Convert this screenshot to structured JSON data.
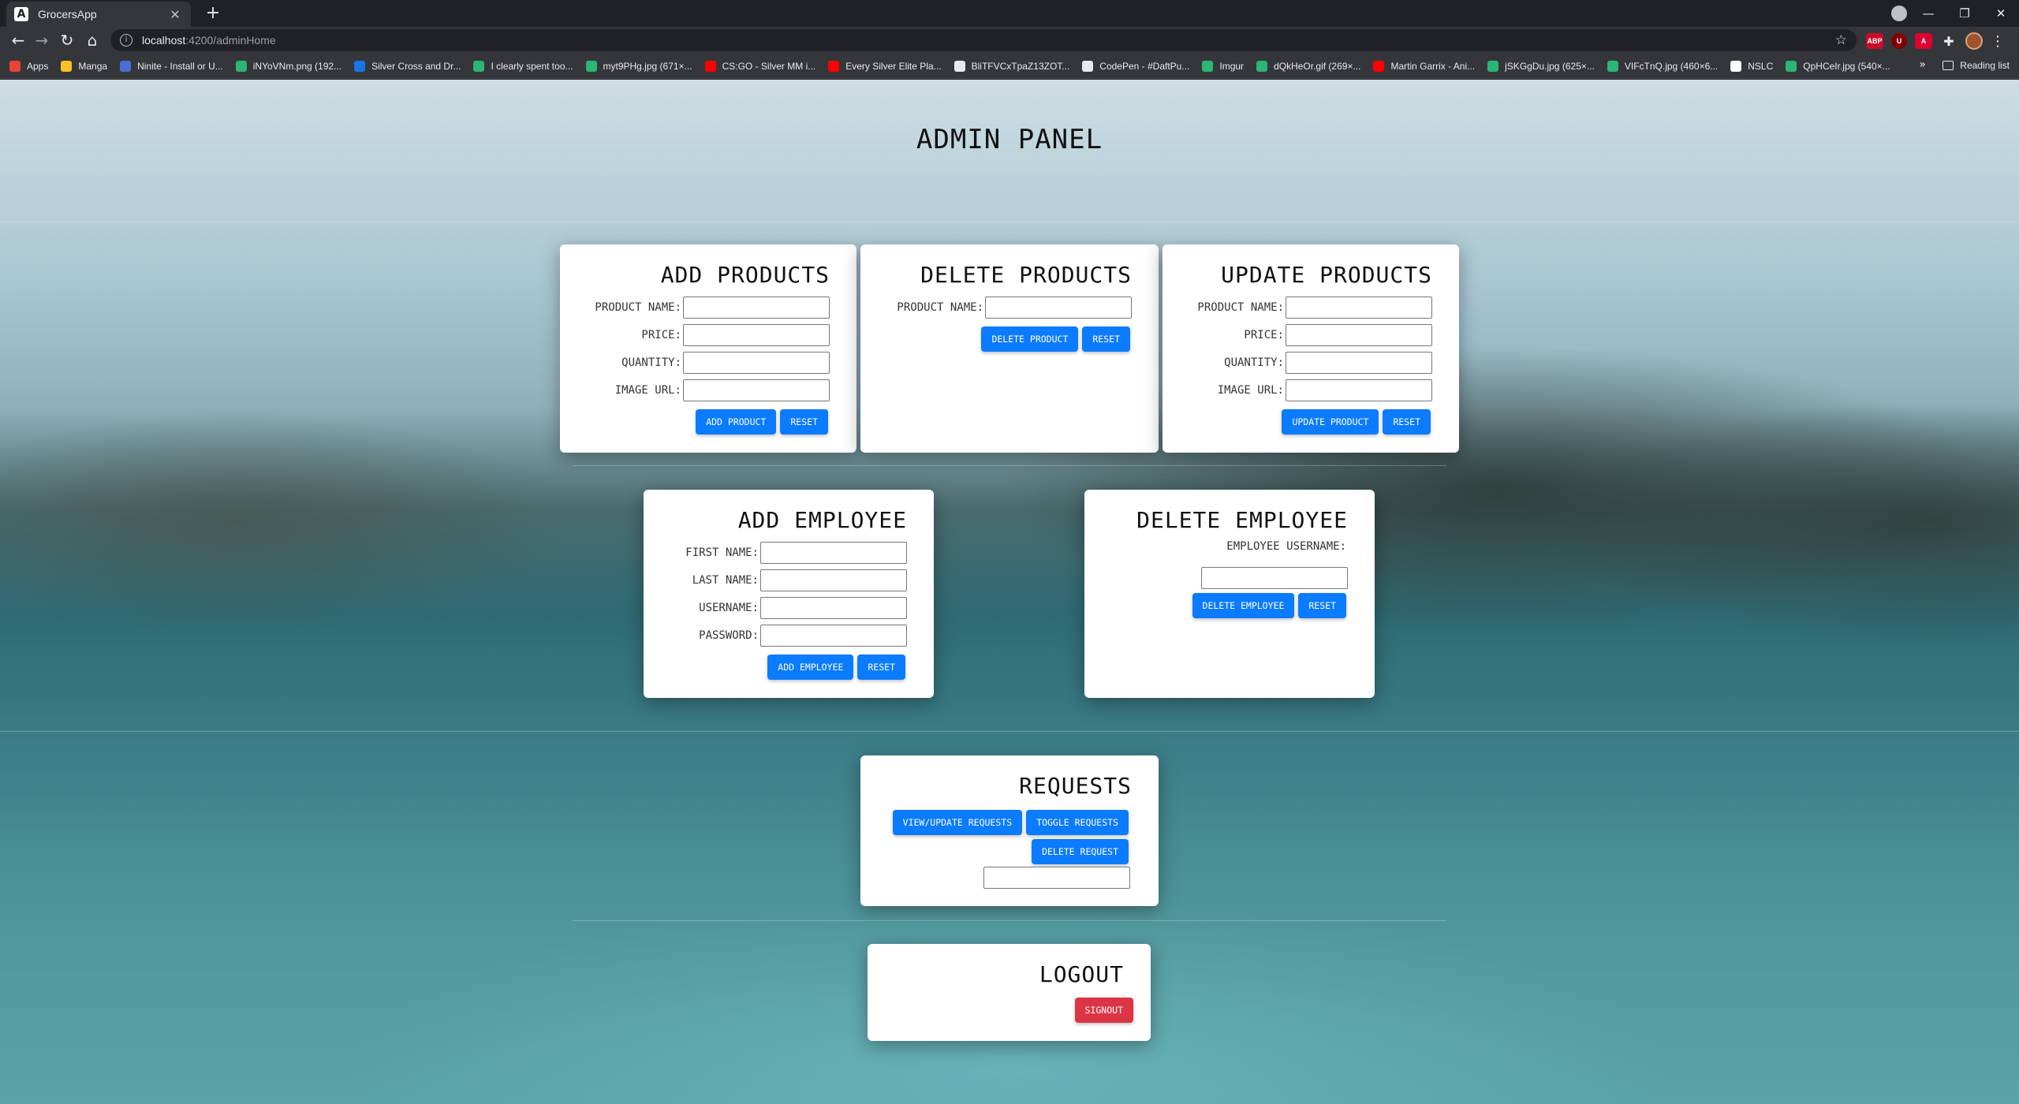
{
  "browser": {
    "tab_title": "GrocersApp",
    "tab_favicon": "A",
    "url_host": "localhost",
    "url_path": ":4200/adminHome",
    "bookmarks": [
      {
        "label": "Apps",
        "color": "#ea4335"
      },
      {
        "label": "Manga",
        "color": "#f6c026"
      },
      {
        "label": "Ninite - Install or U...",
        "color": "#4a6cd4"
      },
      {
        "label": "iNYoVNm.png (192...",
        "color": "#2bb673"
      },
      {
        "label": "Silver Cross and Dr...",
        "color": "#1a73e8"
      },
      {
        "label": "I clearly spent too...",
        "color": "#2bb673"
      },
      {
        "label": "myt9PHg.jpg (671×...",
        "color": "#2bb673"
      },
      {
        "label": "CS:GO - Silver MM i...",
        "color": "#ff0000"
      },
      {
        "label": "Every Silver Elite Pla...",
        "color": "#ff0000"
      },
      {
        "label": "BliTFVCxTpaZ13ZOT...",
        "color": "#e8eaed"
      },
      {
        "label": "CodePen - #DaftPu...",
        "color": "#e8eaed"
      },
      {
        "label": "Imgur",
        "color": "#2bb673"
      },
      {
        "label": "dQkHeOr.gif (269×...",
        "color": "#2bb673"
      },
      {
        "label": "Martin Garrix - Ani...",
        "color": "#ff0000"
      },
      {
        "label": "jSKGgDu.jpg (625×...",
        "color": "#2bb673"
      },
      {
        "label": "VIFcTnQ.jpg (460×6...",
        "color": "#2bb673"
      },
      {
        "label": "NSLC",
        "color": "#ffffff"
      },
      {
        "label": "QpHCeIr.jpg (540×...",
        "color": "#2bb673"
      }
    ],
    "more": "»",
    "reading_list": "Reading list"
  },
  "page": {
    "title": "ADMIN PANEL"
  },
  "add_products": {
    "title": "ADD PRODUCTS",
    "fields": [
      "PRODUCT NAME:",
      "PRICE:",
      "QUANTITY:",
      "IMAGE URL:"
    ],
    "submit": "ADD PRODUCT",
    "reset": "RESET"
  },
  "delete_products": {
    "title": "DELETE PRODUCTS",
    "fields": [
      "PRODUCT NAME:"
    ],
    "submit": "DELETE PRODUCT",
    "reset": "RESET"
  },
  "update_products": {
    "title": "UPDATE PRODUCTS",
    "fields": [
      "PRODUCT NAME:",
      "PRICE:",
      "QUANTITY:",
      "IMAGE URL:"
    ],
    "submit": "UPDATE PRODUCT",
    "reset": "RESET"
  },
  "add_employee": {
    "title": "ADD EMPLOYEE",
    "fields": [
      "FIRST NAME:",
      "LAST NAME:",
      "USERNAME:",
      "PASSWORD:"
    ],
    "submit": "ADD EMPLOYEE",
    "reset": "RESET"
  },
  "delete_employee": {
    "title": "DELETE EMPLOYEE",
    "field": "EMPLOYEE USERNAME:",
    "submit": "DELETE EMPLOYEE",
    "reset": "RESET"
  },
  "requests": {
    "title": "REQUESTS",
    "view": "VIEW/UPDATE REQUESTS",
    "toggle": "TOGGLE REQUESTS",
    "delete": "DELETE REQUEST"
  },
  "logout": {
    "title": "LOGOUT",
    "signout": "SIGNOUT"
  },
  "colors": {
    "primary": "#0b7bff",
    "danger": "#dc3545"
  }
}
